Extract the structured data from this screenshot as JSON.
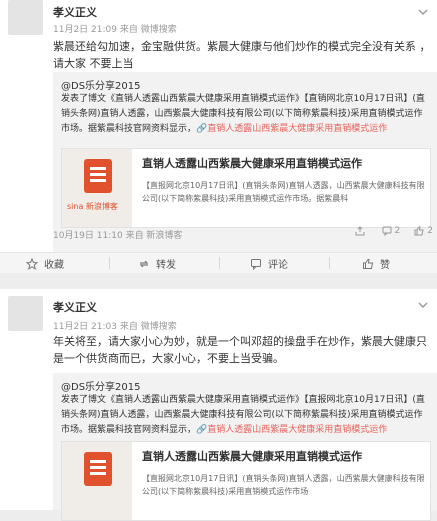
{
  "post1": {
    "username": "孝义正义",
    "meta": "11月2日 21:09 来自 微博搜索",
    "body": "紫晨还给勾加速，金宝融供货。紫晨大健康与他们炒作的模式完全没有关系 ，请大家 不要上当",
    "repost": {
      "author": "@DS乐分享2015",
      "prefix": "发表了博文《直销人透露山西紫晨大健康采用直销模式运作》【直销网北京10月17日讯】(直销头条网)直销人透露，山西紫晨大健康科技有限公司(以下简称紫晨科技)采用直销模式运作市场。",
      "tail": "据紫晨科技官网资料显示，",
      "link": "直销人透露山西紫晨大健康采用直销模式运作",
      "article": {
        "title": "直销人透露山西紫晨大健康采用直销模式运作",
        "desc": "【直报网北京10月17日讯】(直销头条网)直销人透露，山西紫晨大健康科技有限公司(以下简称紫晨科技)采用直销模式运作市场。据紫晨科",
        "logo_text": "sina 新浪博客"
      },
      "time": "10月19日 11:10 来自 新浪博客",
      "share_count": "",
      "comment_count": "2",
      "like_count": "2"
    }
  },
  "actions": {
    "collect": "收藏",
    "forward": "转发",
    "comment": "评论",
    "like": "赞"
  },
  "post2": {
    "username": "孝义正义",
    "meta": "11月2日 21:03 来自 微博搜索",
    "body": "年关将至，请大家小心为妙，就是一个叫邓超的操盘手在炒作，紫晨大健康只是一个供货商而已，大家小心，不要上当受骗。",
    "repost": {
      "author": "@DS乐分享2015",
      "prefix": "发表了博文《直销人透露山西紫晨大健康采用直销模式运作》【直报网北京10月17日讯】(直销头条网)直销人透露，山西紫晨大健康科技有限公司(以下简称紫晨科技)采用直销模式运作市场。",
      "tail": "据紫晨科技官网资料显示，",
      "link": "直销人透露山西紫晨大健康采用直销模式运作",
      "article": {
        "title": "直销人透露山西紫晨大健康采用直销模式运作",
        "desc": "【直报网北京10月17日讯】(直销头条网)直销人透露，山西紫晨大健康科技有限公司(以下简称紫晨科技)采用直销模式运作市场",
        "logo_text": ""
      }
    }
  }
}
